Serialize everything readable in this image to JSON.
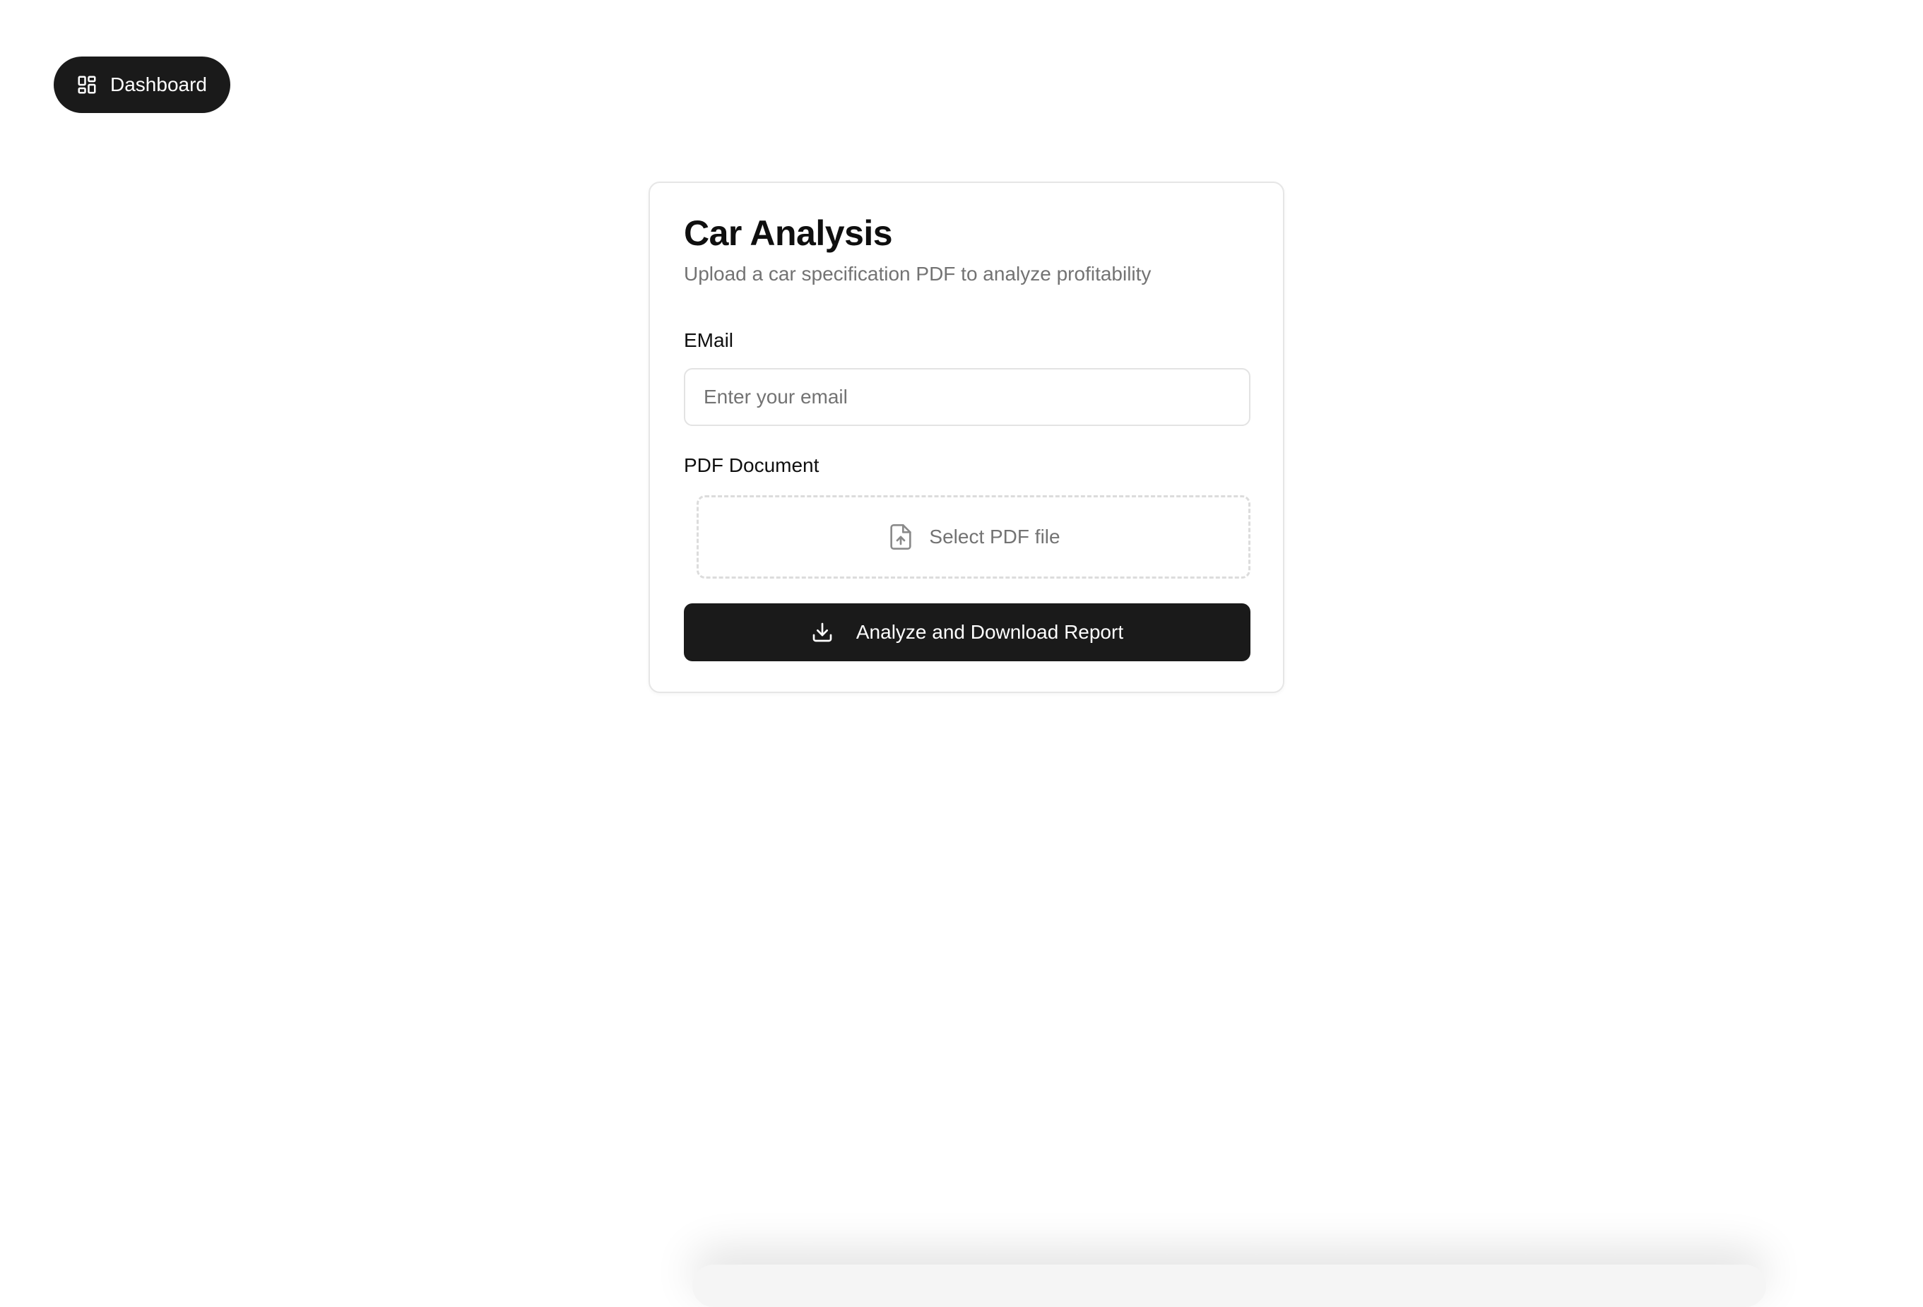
{
  "nav": {
    "dashboard_label": "Dashboard",
    "dashboard_icon": "layout-dashboard-icon"
  },
  "card": {
    "title": "Car Analysis",
    "subtitle": "Upload a car specification PDF to analyze profitability"
  },
  "form": {
    "email_label": "EMail",
    "email_placeholder": "Enter your email",
    "email_value": "",
    "pdf_label": "PDF Document",
    "pdf_select_label": "Select PDF file",
    "pdf_icon": "file-upload-icon",
    "submit_label": "Analyze and Download Report",
    "submit_icon": "download-icon"
  },
  "colors": {
    "primary": "#1a1a1a",
    "muted_text": "#737373",
    "border": "#e3e3e3",
    "background": "#ffffff"
  }
}
